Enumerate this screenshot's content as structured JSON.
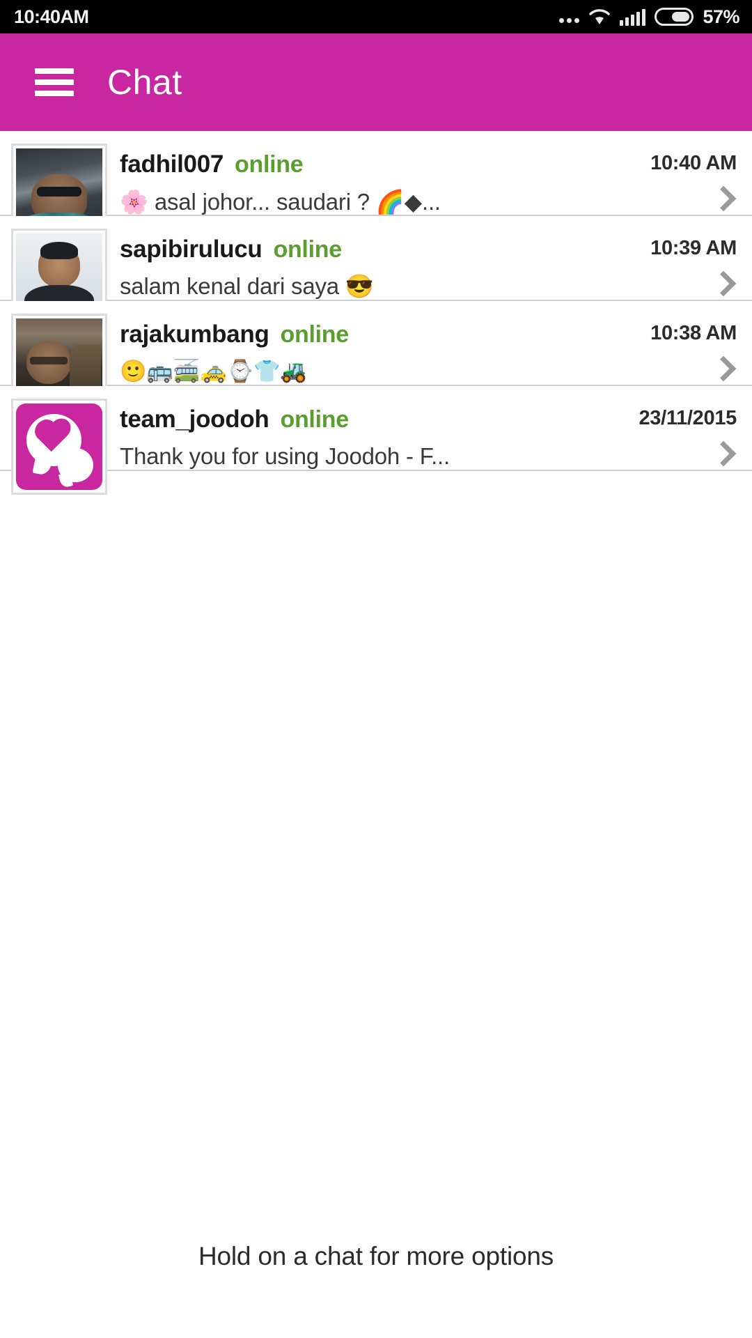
{
  "status_bar": {
    "time": "10:40AM",
    "battery_percent": "57%",
    "icons": [
      "more-dots-icon",
      "wifi-icon",
      "signal-icon",
      "battery-icon"
    ]
  },
  "header": {
    "menu_icon": "hamburger-menu-icon",
    "title": "Chat",
    "background_color": "#c9279f",
    "text_color": "#ffffff"
  },
  "colors": {
    "accent_magenta": "#c9279f",
    "online_green": "#5a9e2f",
    "divider_gray": "#cfcfcf",
    "message_text": "#3a3a3a"
  },
  "chats": [
    {
      "username": "fadhil007",
      "presence": "online",
      "timestamp": "10:40 AM",
      "message": "🌸 asal johor... saudari ? 🌈◆...",
      "avatar": "photo-man-sunglasses-car",
      "chevron": "chevron-right-icon"
    },
    {
      "username": "sapibirulucu",
      "presence": "online",
      "timestamp": "10:39 AM",
      "message": "salam kenal dari saya 😎",
      "avatar": "photo-smiling-man",
      "chevron": "chevron-right-icon"
    },
    {
      "username": "rajakumbang",
      "presence": "online",
      "timestamp": "10:38 AM",
      "message": "🙂🚌🚎🚕⌚👕🚜",
      "avatar": "photo-person-glasses",
      "chevron": "chevron-right-icon"
    },
    {
      "username": "team_joodoh",
      "presence": "online",
      "timestamp": "23/11/2015",
      "message": "Thank you for using Joodoh - F...",
      "avatar": "joodoh-logo-heart-bubbles",
      "chevron": "chevron-right-icon"
    }
  ],
  "footer": {
    "hint": "Hold on a chat for more options"
  }
}
